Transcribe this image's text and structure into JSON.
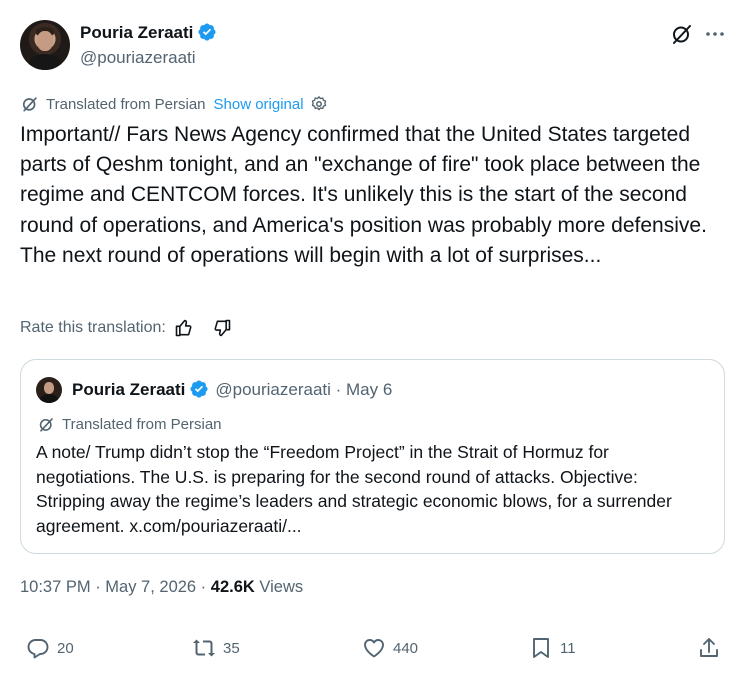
{
  "author": {
    "name": "Pouria Zeraati",
    "handle": "@pouriazeraati",
    "verified_color": "#1d9bf0"
  },
  "header_icons": [
    "grok-icon",
    "more-icon"
  ],
  "translation": {
    "label": "Translated from Persian",
    "show_original": "Show original"
  },
  "post": {
    "text": "Important// Fars News Agency confirmed that the United States targeted parts of Qeshm tonight, and an \"exchange of fire\" took place between the regime and CENTCOM forces. It's unlikely this is the start of the second round of operations, and America's position was probably more defensive. The next round of operations will begin with a lot of surprises..."
  },
  "rate": {
    "label": "Rate this translation:"
  },
  "quote": {
    "name": "Pouria Zeraati",
    "handle_date": "@pouriazeraati · May 6",
    "translation_label": "Translated from Persian",
    "text": "A note/ Trump didn’t stop the “Freedom Project” in the Strait of Hormuz for negotiations. The U.S. is preparing for the second round of attacks. Objective: Stripping away the regime’s leaders and strategic economic blows, for a surrender agreement. x.com/pouriazeraati/..."
  },
  "meta": {
    "time_date": "10:37 PM · May 7, 2026 · ",
    "views_count": "42.6K",
    "views_label": "Views"
  },
  "actions": {
    "replies": "20",
    "reposts": "35",
    "likes": "440",
    "bookmarks": "11"
  },
  "colors": {
    "text": "#0f1419",
    "secondary": "#536471",
    "accent": "#1d9bf0",
    "border": "#cfd9de"
  }
}
